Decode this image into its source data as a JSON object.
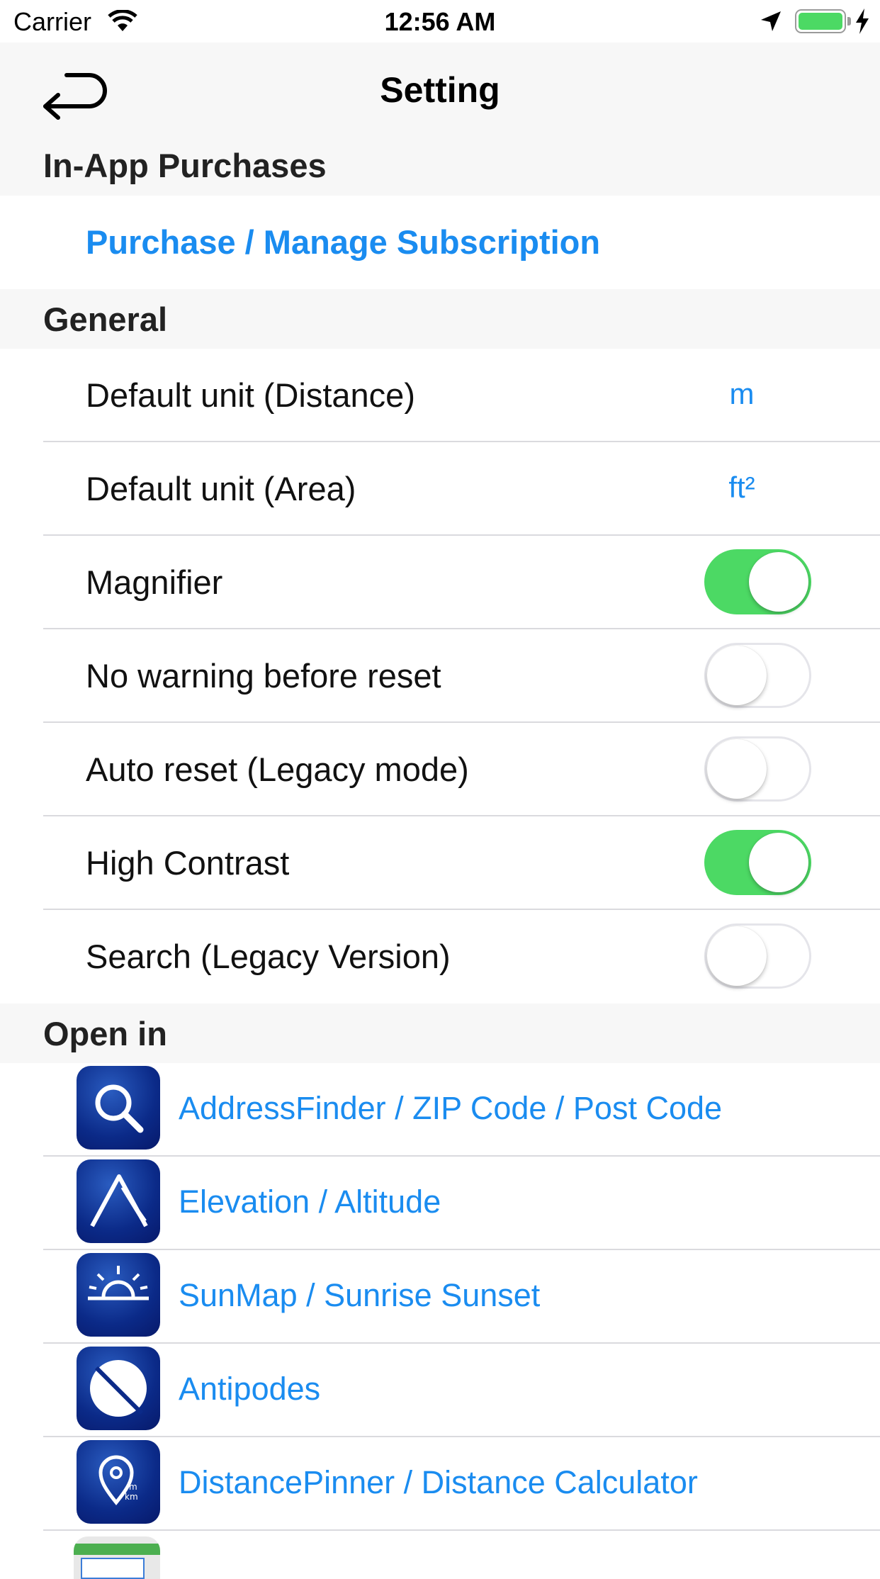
{
  "status_bar": {
    "carrier": "Carrier",
    "time": "12:56 AM",
    "battery_level": 1.0
  },
  "nav": {
    "title": "Setting"
  },
  "sections": {
    "in_app": {
      "header": "In-App Purchases",
      "purchase_label": "Purchase / Manage Subscription"
    },
    "general": {
      "header": "General",
      "items": [
        {
          "label": "Default unit (Distance)",
          "value": "m"
        },
        {
          "label": "Default unit (Area)",
          "value": "ft²"
        },
        {
          "label": "Magnifier",
          "on": true
        },
        {
          "label": "No warning before reset",
          "on": false
        },
        {
          "label": "Auto reset (Legacy mode)",
          "on": false
        },
        {
          "label": "High Contrast",
          "on": true
        },
        {
          "label": "Search (Legacy Version)",
          "on": false
        }
      ]
    },
    "open_in": {
      "header": "Open in",
      "apps": [
        {
          "label": "AddressFinder / ZIP Code / Post Code",
          "icon": "magnifier-icon"
        },
        {
          "label": "Elevation / Altitude",
          "icon": "elevation-icon"
        },
        {
          "label": "SunMap / Sunrise Sunset",
          "icon": "sunrise-icon"
        },
        {
          "label": "Antipodes",
          "icon": "antipodes-icon"
        },
        {
          "label": "DistancePinner / Distance Calculator",
          "icon": "distance-pin-icon"
        }
      ]
    }
  },
  "colors": {
    "link": "#1a8cf0",
    "toggle_on": "#4cd964",
    "section_bg": "#f7f7f7",
    "separator": "#dadade"
  }
}
